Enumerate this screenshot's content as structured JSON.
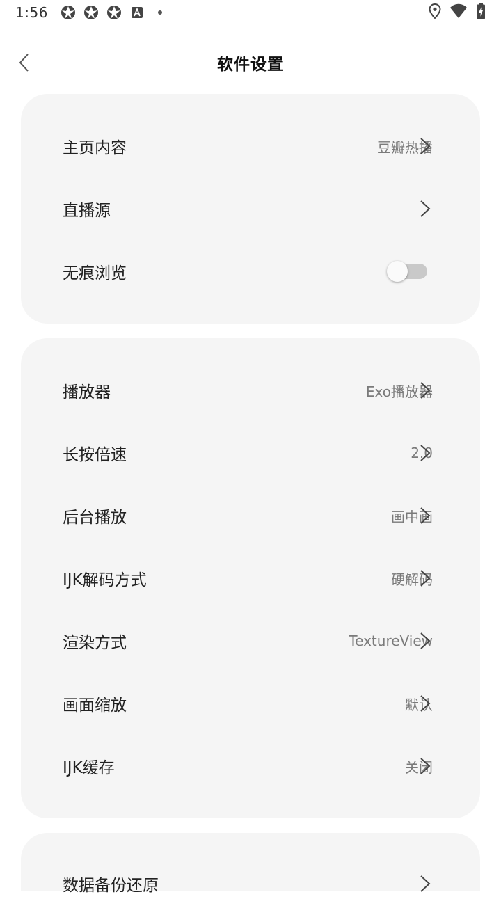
{
  "status_bar": {
    "time": "1:56",
    "left_icons": [
      "aperture-icon",
      "aperture-icon",
      "aperture-icon",
      "text-box-icon",
      "dot-icon"
    ],
    "right_icons": [
      "location-icon",
      "wifi-icon",
      "battery-charging-icon"
    ]
  },
  "header": {
    "title": "软件设置",
    "back_icon": "chevron-left-icon"
  },
  "groups": [
    {
      "rows": [
        {
          "label": "主页内容",
          "value": "豆瓣热播",
          "type": "link"
        },
        {
          "label": "直播源",
          "value": "",
          "type": "link"
        },
        {
          "label": "无痕浏览",
          "type": "toggle",
          "toggle_on": false
        }
      ]
    },
    {
      "rows": [
        {
          "label": "播放器",
          "value": "Exo播放器",
          "type": "link"
        },
        {
          "label": "长按倍速",
          "value": "2.0",
          "type": "link"
        },
        {
          "label": "后台播放",
          "value": "画中画",
          "type": "link"
        },
        {
          "label": "IJK解码方式",
          "value": "硬解码",
          "type": "link"
        },
        {
          "label": "渲染方式",
          "value": "TextureView",
          "type": "link"
        },
        {
          "label": "画面缩放",
          "value": "默认",
          "type": "link"
        },
        {
          "label": "IJK缓存",
          "value": "关闭",
          "type": "link"
        }
      ]
    },
    {
      "rows": [
        {
          "label": "数据备份还原",
          "value": "",
          "type": "link"
        }
      ]
    }
  ],
  "colors": {
    "background": "#ffffff",
    "card": "#f5f5f5",
    "label": "#222222",
    "value": "#7a7a7a",
    "toggle_track_off": "#c9c9c9",
    "toggle_knob": "#fafafa"
  }
}
